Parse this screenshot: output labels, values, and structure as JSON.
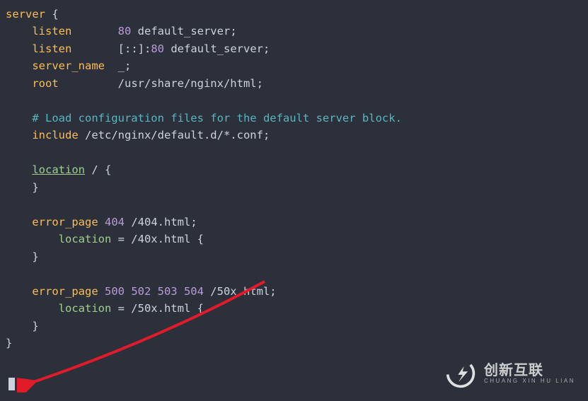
{
  "code": {
    "l1_kw": "server",
    "l1_brace": " {",
    "l2_kw": "listen",
    "l2_rest_num": "80",
    "l2_rest_txt": " default_server",
    "semi": ";",
    "l3_kw": "listen",
    "l3_addr": "[::]:",
    "l3_num": "80",
    "l3_txt": " default_server",
    "l4_kw": "server_name",
    "l4_val": "_",
    "l5_kw": "root",
    "l5_val": "/usr/share/nginx/html",
    "comment": "# Load configuration files for the default server block.",
    "l7_kw": "include",
    "l7_val": " /etc/nginx/default.d/*.conf",
    "loc1": "location",
    "loc1_path": " / ",
    "brace_open": "{",
    "brace_close": "}",
    "ep1_kw": "error_page",
    "ep1_codes": " 404 ",
    "ep1_path": "/404.html",
    "loc_eq1": " = /40x.html ",
    "ep2_kw": "error_page",
    "ep2_codes": " 500 502 503 504 ",
    "ep2_path": "/50x.html",
    "loc_eq2": " = /50x.html "
  },
  "watermark": {
    "cn": "创新互联",
    "en": "CHUANG XIN HU LIAN"
  }
}
